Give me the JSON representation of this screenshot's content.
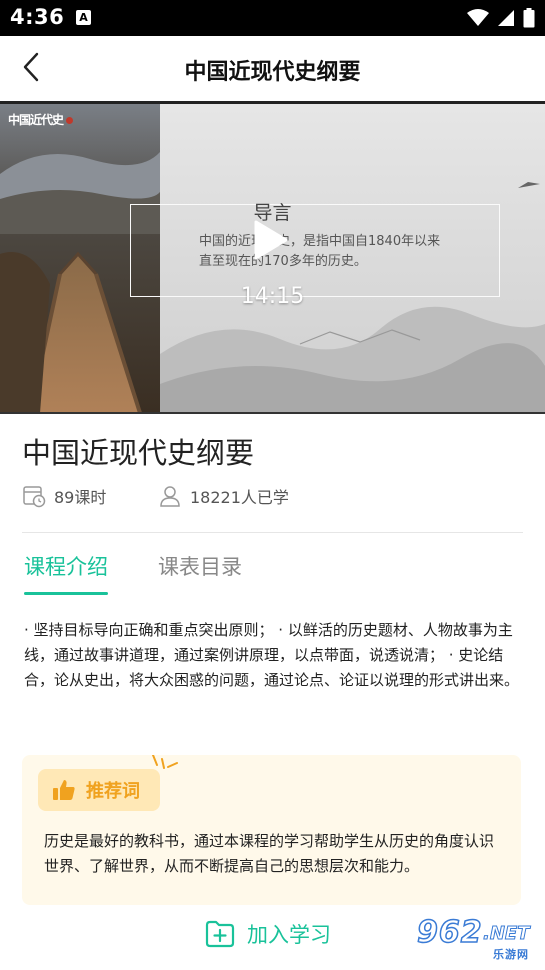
{
  "status_bar": {
    "time": "4:36",
    "notification_letter": "A"
  },
  "header": {
    "title": "中国近现代史纲要"
  },
  "video": {
    "calligraphy_text": "中国近代史",
    "intro_title": "导言",
    "intro_text": "中国的近现代史，是指中国自1840年以来直至现在的170多年的历史。",
    "duration": "14:15"
  },
  "course": {
    "title": "中国近现代史纲要",
    "lessons": "89课时",
    "learners": "18221人已学"
  },
  "tabs": [
    {
      "label": "课程介绍",
      "active": true
    },
    {
      "label": "课表目录",
      "active": false
    }
  ],
  "description": "· 坚持目标导向正确和重点突出原则；  · 以鲜活的历史题材、人物故事为主线，通过故事讲道理，通过案例讲原理，以点带面，说透说清；  · 史论结合，论从史出，将大众困惑的问题，通过论点、论证以说理的形式讲出来。",
  "recommend": {
    "badge_label": "推荐词",
    "text": "历史是最好的教科书，通过本课程的学习帮助学生从历史的角度认识世界、了解世界，从而不断提高自己的思想层次和能力。"
  },
  "bottom_bar": {
    "join_label": "加入学习"
  },
  "watermark": {
    "number": "962",
    "suffix": ".NET",
    "cn_text": "乐游网"
  },
  "colors": {
    "accent": "#19c29a",
    "recommend_bg": "#fff9ea",
    "recommend_badge_bg": "#ffe8b6",
    "recommend_orange": "#f0a21f"
  }
}
